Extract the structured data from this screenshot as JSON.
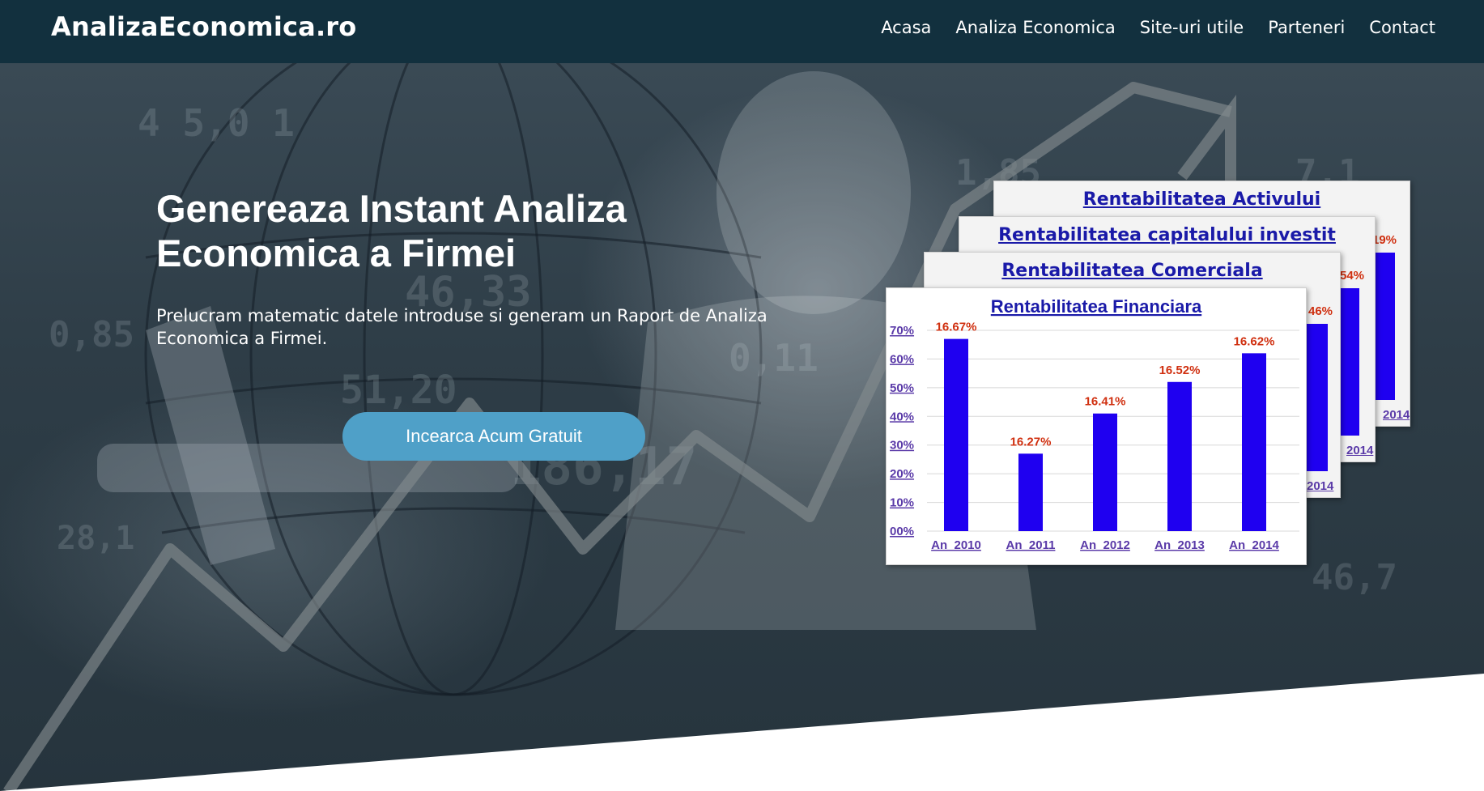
{
  "header": {
    "brand": "AnalizaEconomica.ro",
    "nav": [
      "Acasa",
      "Analiza Economica",
      "Site-uri utile",
      "Parteneri",
      "Contact"
    ]
  },
  "hero": {
    "title": "Genereaza Instant Analiza Economica a Firmei",
    "subtitle": "Prelucram matematic datele introduse si generam un Raport de Analiza Economica a Firmei.",
    "cta_label": "Incearca Acum Gratuit"
  },
  "cards": {
    "activ": {
      "title": "Rentabilitatea Activului",
      "peek_value": "19%",
      "peek_year": "2014"
    },
    "capital": {
      "title": "Rentabilitatea capitalului investit",
      "peek_value": "54%",
      "peek_year": "2014"
    },
    "comerciala": {
      "title": "Rentabilitatea Comerciala",
      "peek_value": "46%",
      "peek_year": "2014"
    }
  },
  "chart_data": {
    "type": "bar",
    "title": "Rentabilitatea Financiara",
    "categories": [
      "An_2010",
      "An_2011",
      "An_2012",
      "An_2013",
      "An_2014"
    ],
    "bar_heights_pct": [
      67,
      27,
      41,
      52,
      62
    ],
    "value_labels": [
      "16.67%",
      "16.27%",
      "16.41%",
      "16.52%",
      "16.62%"
    ],
    "y_ticks": [
      "00%",
      "10%",
      "20%",
      "30%",
      "40%",
      "50%",
      "60%",
      "70%"
    ],
    "ylim": [
      0,
      70
    ],
    "grid": true,
    "bar_color": "#1f00f0",
    "label_color": "#d03010",
    "axis_label_color": "#5a3aa8"
  },
  "colors": {
    "header_bg": "#12303e",
    "cta_bg": "#4fa0c8",
    "card_title": "#1a1aa8"
  }
}
